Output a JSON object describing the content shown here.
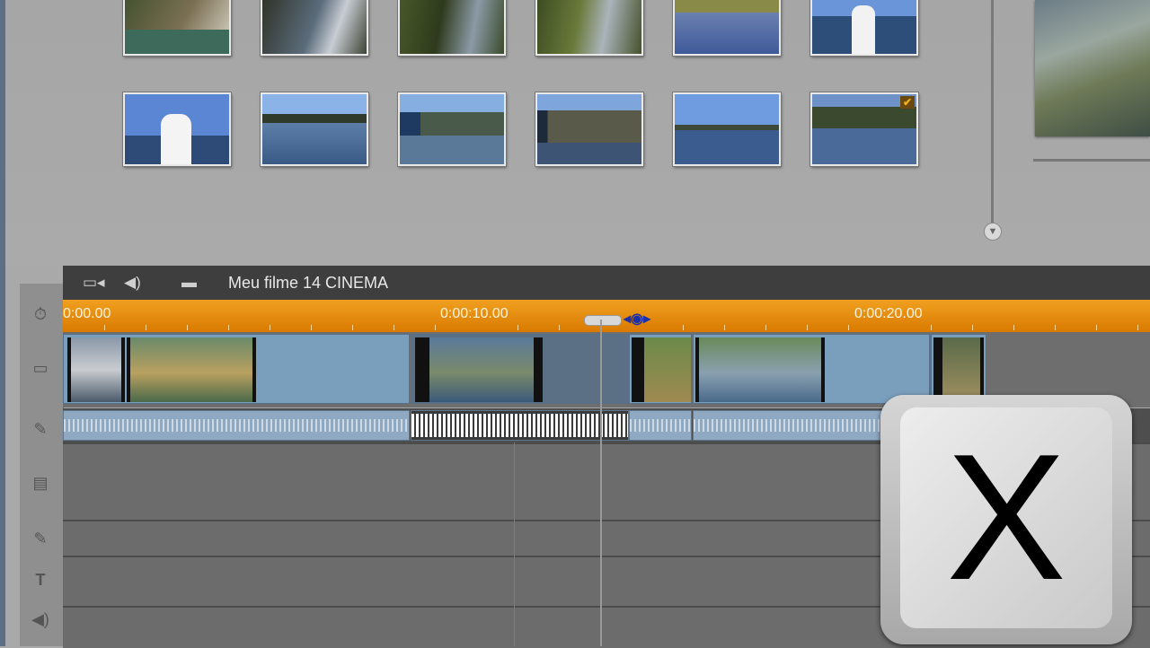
{
  "timeline": {
    "project_title": "Meu filme 14 CINEMA",
    "header_icons": [
      "camera-icon",
      "speaker-icon",
      "folder-icon"
    ],
    "ruler_labels": [
      "0:00.00",
      "0:00:10.00",
      "0:00:20.00"
    ]
  },
  "side_icons": [
    "clock-icon",
    "video-track-icon",
    "audio-mic-icon",
    "title-track-icon",
    "mic-icon",
    "text-icon",
    "speaker-icon"
  ],
  "overlay_key": {
    "letter": "X"
  },
  "library": {
    "rows": 2,
    "thumbs_per_row": 6,
    "selected_thumb_checkmark": "✔"
  },
  "colors": {
    "ruler": "#e68a0a",
    "clip": "#7a9fbd",
    "panel": "#a9a9a9",
    "header": "#3e3e3e"
  }
}
